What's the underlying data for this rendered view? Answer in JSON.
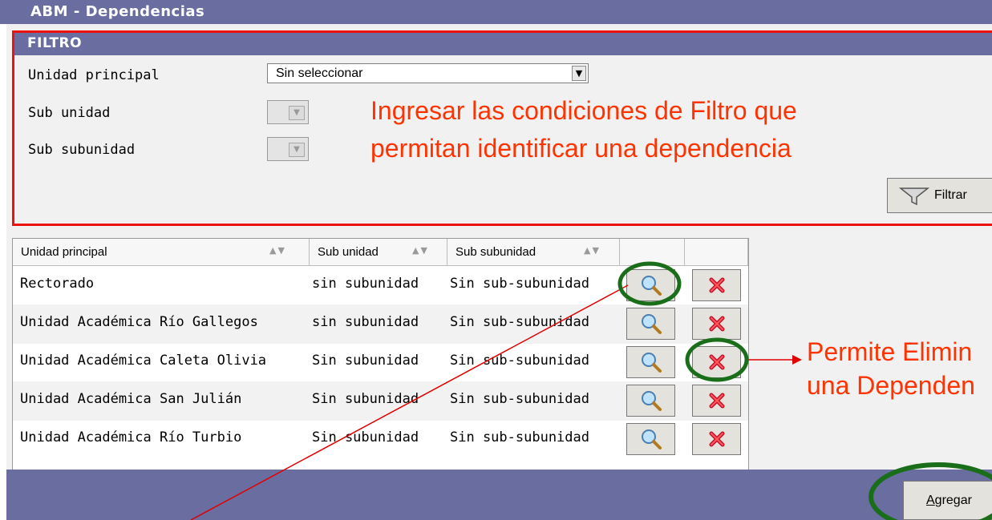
{
  "window": {
    "title": "ABM - Dependencias"
  },
  "filter": {
    "header": "FILTRO",
    "fields": [
      {
        "label": "Unidad principal",
        "value": "Sin seleccionar"
      },
      {
        "label": "Sub unidad",
        "value": ""
      },
      {
        "label": "Sub subunidad",
        "value": ""
      }
    ],
    "annotation_line1": "Ingresar las condiciones de Filtro que",
    "annotation_line2": "permitan identificar una dependencia",
    "button_label": "Filtrar"
  },
  "grid": {
    "columns": [
      "Unidad principal",
      "Sub unidad",
      "Sub subunidad",
      "",
      ""
    ],
    "rows": [
      [
        "Rectorado",
        "sin subunidad",
        "Sin sub-subunidad"
      ],
      [
        "Unidad Académica Río Gallegos",
        "sin subunidad",
        "Sin sub-subunidad"
      ],
      [
        "Unidad Académica Caleta Olivia",
        "Sin subunidad",
        "Sin sub-subunidad"
      ],
      [
        "Unidad Académica San Julián",
        "Sin subunidad",
        "Sin sub-subunidad"
      ],
      [
        "Unidad Académica Río Turbio",
        "Sin subunidad",
        "Sin sub-subunidad"
      ]
    ],
    "view_icon": "magnifier-icon",
    "delete_icon": "delete-x-icon"
  },
  "annotation_delete": {
    "line1": "Permite Elimin",
    "line2": "una Dependen"
  },
  "footer": {
    "add_button": "Agregar"
  },
  "colors": {
    "titlebar": "#6a6da0",
    "annotation": "#ff3300",
    "highlight_circle": "#1a6e1a",
    "filter_border": "#ee1111"
  }
}
